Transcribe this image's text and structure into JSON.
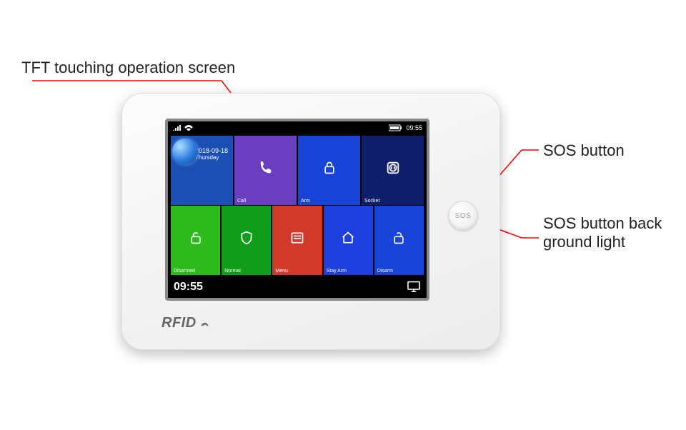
{
  "callouts": {
    "screen": "TFT touching operation screen",
    "sos_button": "SOS button",
    "sos_light": "SOS button back ground light"
  },
  "device": {
    "rfid_label": "RFID",
    "sos_label": "SOS"
  },
  "statusbar": {
    "time_small": "09:55"
  },
  "tiles": {
    "date": {
      "date": "2018-09-18",
      "day": "Thursday"
    },
    "call": {
      "label": "Call"
    },
    "arm": {
      "label": "Arm"
    },
    "socket": {
      "label": "Socket"
    },
    "disarmed": {
      "label": "Disarmed"
    },
    "normal": {
      "label": "Normal"
    },
    "menu": {
      "label": "Menu"
    },
    "stayarm": {
      "label": "Stay Arm"
    },
    "disarm": {
      "label": "Disarm"
    }
  },
  "bottombar": {
    "clock": "09:55"
  }
}
